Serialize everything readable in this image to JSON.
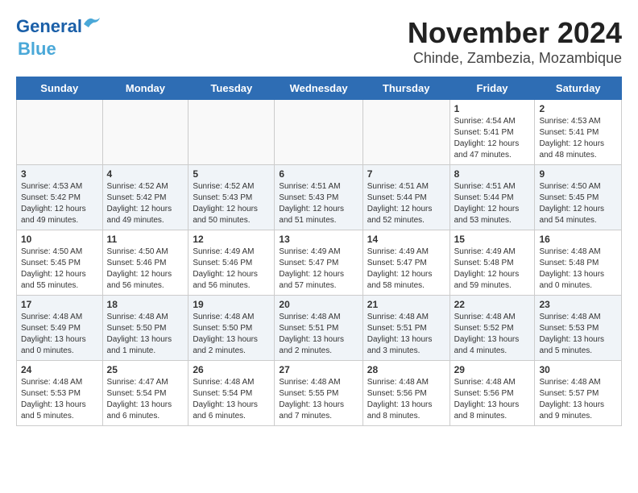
{
  "header": {
    "title": "November 2024",
    "subtitle": "Chinde, Zambezia, Mozambique",
    "logo_general": "General",
    "logo_blue": "Blue"
  },
  "weekdays": [
    "Sunday",
    "Monday",
    "Tuesday",
    "Wednesday",
    "Thursday",
    "Friday",
    "Saturday"
  ],
  "weeks": [
    [
      {
        "day": "",
        "info": ""
      },
      {
        "day": "",
        "info": ""
      },
      {
        "day": "",
        "info": ""
      },
      {
        "day": "",
        "info": ""
      },
      {
        "day": "",
        "info": ""
      },
      {
        "day": "1",
        "info": "Sunrise: 4:54 AM\nSunset: 5:41 PM\nDaylight: 12 hours\nand 47 minutes."
      },
      {
        "day": "2",
        "info": "Sunrise: 4:53 AM\nSunset: 5:41 PM\nDaylight: 12 hours\nand 48 minutes."
      }
    ],
    [
      {
        "day": "3",
        "info": "Sunrise: 4:53 AM\nSunset: 5:42 PM\nDaylight: 12 hours\nand 49 minutes."
      },
      {
        "day": "4",
        "info": "Sunrise: 4:52 AM\nSunset: 5:42 PM\nDaylight: 12 hours\nand 49 minutes."
      },
      {
        "day": "5",
        "info": "Sunrise: 4:52 AM\nSunset: 5:43 PM\nDaylight: 12 hours\nand 50 minutes."
      },
      {
        "day": "6",
        "info": "Sunrise: 4:51 AM\nSunset: 5:43 PM\nDaylight: 12 hours\nand 51 minutes."
      },
      {
        "day": "7",
        "info": "Sunrise: 4:51 AM\nSunset: 5:44 PM\nDaylight: 12 hours\nand 52 minutes."
      },
      {
        "day": "8",
        "info": "Sunrise: 4:51 AM\nSunset: 5:44 PM\nDaylight: 12 hours\nand 53 minutes."
      },
      {
        "day": "9",
        "info": "Sunrise: 4:50 AM\nSunset: 5:45 PM\nDaylight: 12 hours\nand 54 minutes."
      }
    ],
    [
      {
        "day": "10",
        "info": "Sunrise: 4:50 AM\nSunset: 5:45 PM\nDaylight: 12 hours\nand 55 minutes."
      },
      {
        "day": "11",
        "info": "Sunrise: 4:50 AM\nSunset: 5:46 PM\nDaylight: 12 hours\nand 56 minutes."
      },
      {
        "day": "12",
        "info": "Sunrise: 4:49 AM\nSunset: 5:46 PM\nDaylight: 12 hours\nand 56 minutes."
      },
      {
        "day": "13",
        "info": "Sunrise: 4:49 AM\nSunset: 5:47 PM\nDaylight: 12 hours\nand 57 minutes."
      },
      {
        "day": "14",
        "info": "Sunrise: 4:49 AM\nSunset: 5:47 PM\nDaylight: 12 hours\nand 58 minutes."
      },
      {
        "day": "15",
        "info": "Sunrise: 4:49 AM\nSunset: 5:48 PM\nDaylight: 12 hours\nand 59 minutes."
      },
      {
        "day": "16",
        "info": "Sunrise: 4:48 AM\nSunset: 5:48 PM\nDaylight: 13 hours\nand 0 minutes."
      }
    ],
    [
      {
        "day": "17",
        "info": "Sunrise: 4:48 AM\nSunset: 5:49 PM\nDaylight: 13 hours\nand 0 minutes."
      },
      {
        "day": "18",
        "info": "Sunrise: 4:48 AM\nSunset: 5:50 PM\nDaylight: 13 hours\nand 1 minute."
      },
      {
        "day": "19",
        "info": "Sunrise: 4:48 AM\nSunset: 5:50 PM\nDaylight: 13 hours\nand 2 minutes."
      },
      {
        "day": "20",
        "info": "Sunrise: 4:48 AM\nSunset: 5:51 PM\nDaylight: 13 hours\nand 2 minutes."
      },
      {
        "day": "21",
        "info": "Sunrise: 4:48 AM\nSunset: 5:51 PM\nDaylight: 13 hours\nand 3 minutes."
      },
      {
        "day": "22",
        "info": "Sunrise: 4:48 AM\nSunset: 5:52 PM\nDaylight: 13 hours\nand 4 minutes."
      },
      {
        "day": "23",
        "info": "Sunrise: 4:48 AM\nSunset: 5:53 PM\nDaylight: 13 hours\nand 5 minutes."
      }
    ],
    [
      {
        "day": "24",
        "info": "Sunrise: 4:48 AM\nSunset: 5:53 PM\nDaylight: 13 hours\nand 5 minutes."
      },
      {
        "day": "25",
        "info": "Sunrise: 4:47 AM\nSunset: 5:54 PM\nDaylight: 13 hours\nand 6 minutes."
      },
      {
        "day": "26",
        "info": "Sunrise: 4:48 AM\nSunset: 5:54 PM\nDaylight: 13 hours\nand 6 minutes."
      },
      {
        "day": "27",
        "info": "Sunrise: 4:48 AM\nSunset: 5:55 PM\nDaylight: 13 hours\nand 7 minutes."
      },
      {
        "day": "28",
        "info": "Sunrise: 4:48 AM\nSunset: 5:56 PM\nDaylight: 13 hours\nand 8 minutes."
      },
      {
        "day": "29",
        "info": "Sunrise: 4:48 AM\nSunset: 5:56 PM\nDaylight: 13 hours\nand 8 minutes."
      },
      {
        "day": "30",
        "info": "Sunrise: 4:48 AM\nSunset: 5:57 PM\nDaylight: 13 hours\nand 9 minutes."
      }
    ]
  ]
}
